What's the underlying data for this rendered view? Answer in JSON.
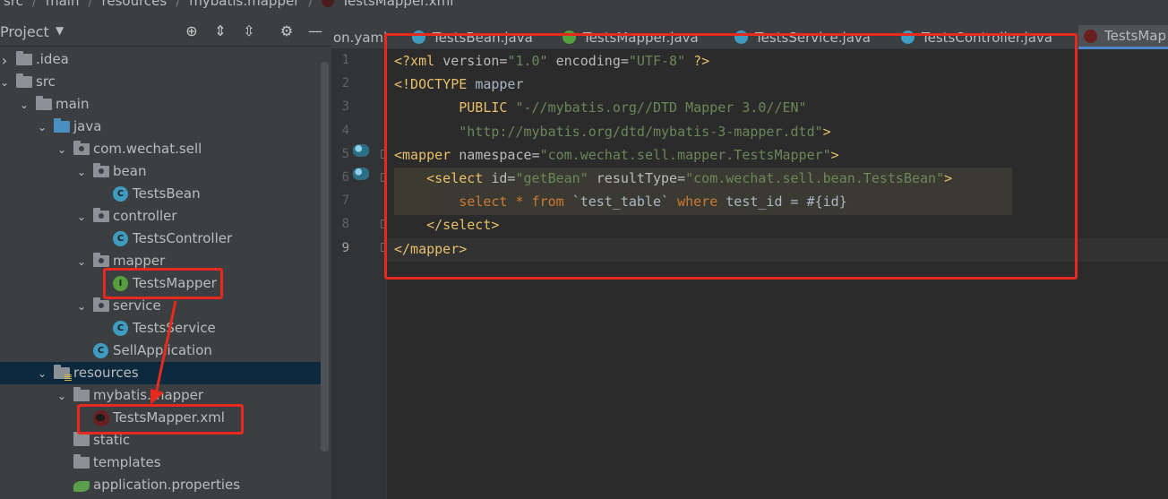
{
  "breadcrumb": [
    "src",
    "main",
    "resources",
    "mybatis.mapper",
    "TestsMapper.xml"
  ],
  "sidebar": {
    "title": "Project",
    "tree": [
      {
        "label": ".idea",
        "level": 0,
        "icon": "folder",
        "expanded": false
      },
      {
        "label": "src",
        "level": 0,
        "icon": "folder",
        "expanded": true
      },
      {
        "label": "main",
        "level": 1,
        "icon": "folder",
        "expanded": true
      },
      {
        "label": "java",
        "level": 2,
        "icon": "folder-blue",
        "expanded": true
      },
      {
        "label": "com.wechat.sell",
        "level": 3,
        "icon": "package",
        "expanded": true
      },
      {
        "label": "bean",
        "level": 4,
        "icon": "package",
        "expanded": true
      },
      {
        "label": "TestsBean",
        "level": 5,
        "icon": "class"
      },
      {
        "label": "controller",
        "level": 4,
        "icon": "package",
        "expanded": true
      },
      {
        "label": "TestsController",
        "level": 5,
        "icon": "class"
      },
      {
        "label": "mapper",
        "level": 4,
        "icon": "package",
        "expanded": true
      },
      {
        "label": "TestsMapper",
        "level": 5,
        "icon": "interface"
      },
      {
        "label": "service",
        "level": 4,
        "icon": "package",
        "expanded": true
      },
      {
        "label": "TestsService",
        "level": 5,
        "icon": "class"
      },
      {
        "label": "SellApplication",
        "level": 4,
        "icon": "spring-class"
      },
      {
        "label": "resources",
        "level": 2,
        "icon": "resources",
        "expanded": true,
        "selected": true
      },
      {
        "label": "mybatis.mapper",
        "level": 3,
        "icon": "folder",
        "expanded": true
      },
      {
        "label": "TestsMapper.xml",
        "level": 4,
        "icon": "xml"
      },
      {
        "label": "static",
        "level": 3,
        "icon": "folder"
      },
      {
        "label": "templates",
        "level": 3,
        "icon": "folder"
      },
      {
        "label": "application.properties",
        "level": 3,
        "icon": "properties"
      }
    ]
  },
  "tabs": [
    {
      "label": "on.yaml",
      "icon": "none"
    },
    {
      "label": "TestsBean.java",
      "icon": "class"
    },
    {
      "label": "TestsMapper.java",
      "icon": "interface"
    },
    {
      "label": "TestsService.java",
      "icon": "class"
    },
    {
      "label": "TestsController.java",
      "icon": "class"
    },
    {
      "label": "TestsMap",
      "icon": "xml",
      "active": true
    }
  ],
  "line_numbers": [
    "1",
    "2",
    "3",
    "4",
    "5",
    "6",
    "7",
    "8",
    "9"
  ],
  "code": [
    [
      {
        "t": "<?xml ",
        "c": "tag"
      },
      {
        "t": "version=",
        "c": "attr"
      },
      {
        "t": "\"1.0\"",
        "c": "str"
      },
      {
        "t": " encoding=",
        "c": "attr"
      },
      {
        "t": "\"UTF-8\"",
        "c": "str"
      },
      {
        "t": " ?>",
        "c": "tag"
      }
    ],
    [
      {
        "t": "<!DOCTYPE ",
        "c": "tag"
      },
      {
        "t": "mapper",
        "c": "plain"
      }
    ],
    [
      {
        "t": "        PUBLIC ",
        "c": "dt"
      },
      {
        "t": "\"-//mybatis.org//DTD Mapper 3.0//EN\"",
        "c": "str"
      }
    ],
    [
      {
        "t": "        \"http://mybatis.org/dtd/mybatis-3-mapper.dtd\"",
        "c": "str"
      },
      {
        "t": ">",
        "c": "tag"
      }
    ],
    [
      {
        "t": "<mapper ",
        "c": "tag"
      },
      {
        "t": "namespace=",
        "c": "attr"
      },
      {
        "t": "\"com.wechat.sell.mapper.TestsMapper\"",
        "c": "str"
      },
      {
        "t": ">",
        "c": "tag"
      }
    ],
    [
      {
        "t": "    <select ",
        "c": "tag"
      },
      {
        "t": "id=",
        "c": "attr"
      },
      {
        "t": "\"getBean\"",
        "c": "str"
      },
      {
        "t": " resultType=",
        "c": "attr"
      },
      {
        "t": "\"com.wechat.sell.bean.TestsBean\"",
        "c": "str"
      },
      {
        "t": ">",
        "c": "tag"
      }
    ],
    [
      {
        "t": "        select ",
        "c": "kw"
      },
      {
        "t": "* ",
        "c": "kw"
      },
      {
        "t": "from ",
        "c": "kw"
      },
      {
        "t": "`test_table` ",
        "c": "plain"
      },
      {
        "t": "where ",
        "c": "kw"
      },
      {
        "t": "test_id = #{id}",
        "c": "plain"
      }
    ],
    [
      {
        "t": "    </select>",
        "c": "tag"
      }
    ],
    [
      {
        "t": "</mapper>",
        "c": "tag"
      }
    ]
  ],
  "colors": {
    "annotation": "#e8291d",
    "selection": "#0d293e",
    "accent": "#4a88c7"
  }
}
